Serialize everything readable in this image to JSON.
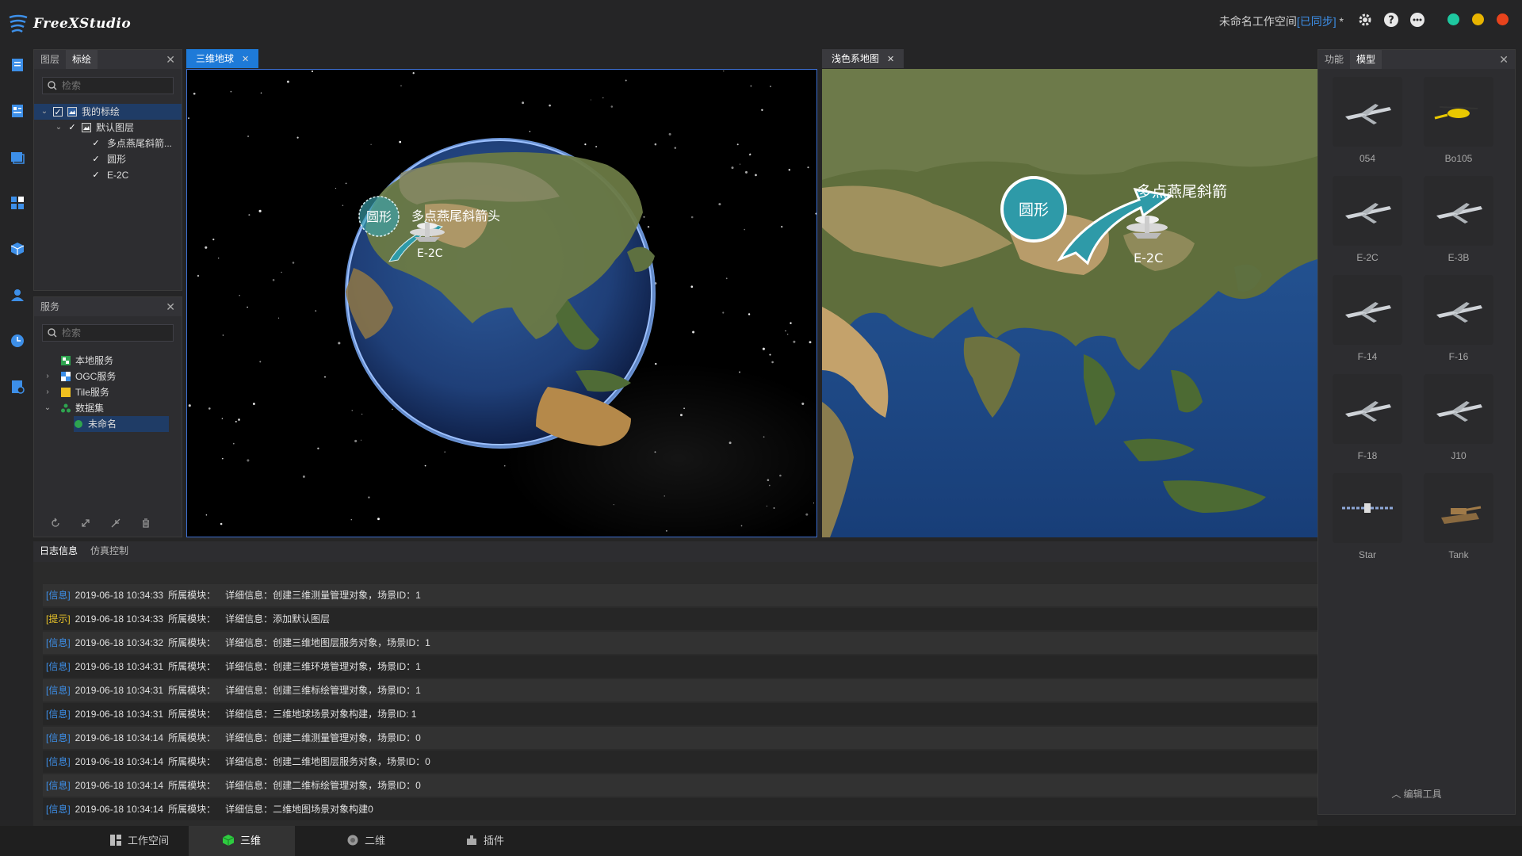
{
  "app": {
    "logo_text": "FreeXStudio",
    "workspace_name": "未命名工作空间",
    "sync_status": "[已同步]",
    "unsaved_mark": " *",
    "accent_color": "#3d8fe8",
    "window_dots": [
      "#1ec8a0",
      "#e8b400",
      "#e8431c"
    ]
  },
  "toolbar_icons": [
    "settings-icon",
    "help-icon",
    "chat-icon"
  ],
  "rail_icons": [
    "document-icon",
    "layers-list-icon",
    "window-icon",
    "grid-icon",
    "cube-icon",
    "user-icon",
    "clock-icon",
    "settings-doc-icon"
  ],
  "left_top_panel": {
    "tabs": [
      "图层",
      "标绘"
    ],
    "active_tab": "标绘",
    "search_placeholder": "检索",
    "tree": [
      {
        "label": "我的标绘",
        "level": 0,
        "checked": true,
        "selected": true,
        "expanded": true
      },
      {
        "label": "默认图层",
        "level": 1,
        "checked": true,
        "expanded": true
      },
      {
        "label": "多点燕尾斜箭...",
        "level": 2,
        "checked": true
      },
      {
        "label": "圆形",
        "level": 2,
        "checked": true
      },
      {
        "label": "E-2C",
        "level": 2,
        "checked": true
      }
    ]
  },
  "services_panel": {
    "title": "服务",
    "search_placeholder": "检索",
    "tree": [
      {
        "label": "本地服务",
        "level": 0,
        "has_children": false
      },
      {
        "label": "OGC服务",
        "level": 0,
        "has_children": true,
        "expanded": false
      },
      {
        "label": "Tile服务",
        "level": 0,
        "has_children": true,
        "expanded": false
      },
      {
        "label": "数据集",
        "level": 0,
        "has_children": true,
        "expanded": true
      },
      {
        "label": "未命名",
        "level": 1,
        "selected": true
      }
    ],
    "footer_icons": [
      "refresh-icon",
      "expand-icon",
      "collapse-icon",
      "delete-icon"
    ]
  },
  "view3d": {
    "tab_label": "三维地球",
    "labels": {
      "circle": "圆形",
      "arrow": "多点燕尾斜箭头",
      "aircraft": "E-2C"
    }
  },
  "view2d": {
    "tab_label": "浅色系地图",
    "labels": {
      "circle": "圆形",
      "arrow": "多点燕尾斜箭",
      "aircraft": "E-2C"
    }
  },
  "model_panel": {
    "tabs": [
      "功能",
      "模型"
    ],
    "active_tab": "模型",
    "models": [
      "054",
      "Bo105",
      "E-2C",
      "E-3B",
      "F-14",
      "F-16",
      "F-18",
      "J10",
      "Star",
      "Tank"
    ],
    "footer": "编辑工具"
  },
  "log_panel": {
    "tabs": [
      "日志信息",
      "仿真控制"
    ],
    "active_tab": "日志信息",
    "rows": [
      {
        "tag": "[信息]",
        "type": "info",
        "time": "2019-06-18 10:34:33",
        "module": "所属模块：",
        "detail": "详细信息：创建三维测量管理对象，场景ID：1"
      },
      {
        "tag": "[提示]",
        "type": "warn",
        "time": "2019-06-18 10:34:33",
        "module": "所属模块：",
        "detail": "详细信息：添加默认图层"
      },
      {
        "tag": "[信息]",
        "type": "info",
        "time": "2019-06-18 10:34:32",
        "module": "所属模块：",
        "detail": "详细信息：创建三维地图层服务对象，场景ID：1"
      },
      {
        "tag": "[信息]",
        "type": "info",
        "time": "2019-06-18 10:34:31",
        "module": "所属模块：",
        "detail": "详细信息：创建三维环境管理对象，场景ID：1"
      },
      {
        "tag": "[信息]",
        "type": "info",
        "time": "2019-06-18 10:34:31",
        "module": "所属模块：",
        "detail": "详细信息：创建三维标绘管理对象，场景ID：1"
      },
      {
        "tag": "[信息]",
        "type": "info",
        "time": "2019-06-18 10:34:31",
        "module": "所属模块：",
        "detail": "详细信息：三维地球场景对象构建，场景ID: 1"
      },
      {
        "tag": "[信息]",
        "type": "info",
        "time": "2019-06-18 10:34:14",
        "module": "所属模块：",
        "detail": "详细信息：创建二维测量管理对象，场景ID：0"
      },
      {
        "tag": "[信息]",
        "type": "info",
        "time": "2019-06-18 10:34:14",
        "module": "所属模块：",
        "detail": "详细信息：创建二维地图层服务对象，场景ID：0"
      },
      {
        "tag": "[信息]",
        "type": "info",
        "time": "2019-06-18 10:34:14",
        "module": "所属模块：",
        "detail": "详细信息：创建二维标绘管理对象，场景ID：0"
      },
      {
        "tag": "[信息]",
        "type": "info",
        "time": "2019-06-18 10:34:14",
        "module": "所属模块：",
        "detail": "详细信息：二维地图场景对象构建0"
      }
    ]
  },
  "bottom_tabs": [
    {
      "label": "工作空间",
      "icon": "workspace-icon",
      "active": false
    },
    {
      "label": "三维",
      "icon": "cube-icon",
      "active": true
    },
    {
      "label": "二维",
      "icon": "globe-icon",
      "active": false
    },
    {
      "label": "插件",
      "icon": "plugin-icon",
      "active": false
    }
  ]
}
